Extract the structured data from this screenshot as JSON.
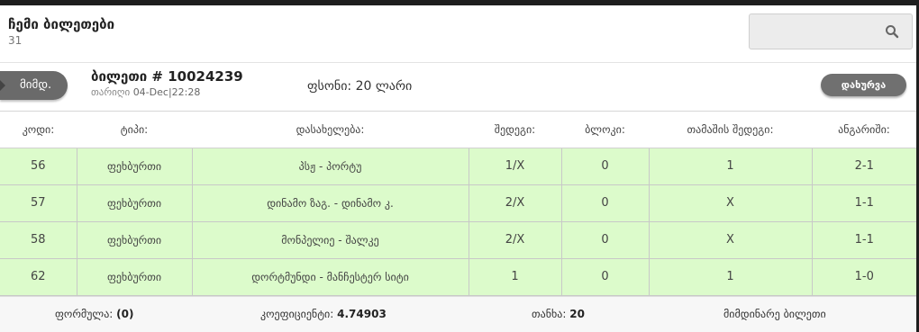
{
  "header": {
    "title": "ჩემი ბილეთები",
    "count": "31"
  },
  "search": {
    "icon": "search-icon"
  },
  "ticket": {
    "status": "მიმდ.",
    "title": "ბილეთი # 10024239",
    "date_label": "თარიღი",
    "date_value": "04-Dec|22:28",
    "price": "ფსონი: 20 ლარი",
    "close_label": "დახურვა"
  },
  "table": {
    "headers": [
      "კოდი:",
      "ტიპი:",
      "დასახელება:",
      "შედეგი:",
      "ბლოკი:",
      "თამაშის შედეგი:",
      "ანგარიში:"
    ],
    "rows": [
      [
        "56",
        "ფეხბურთი",
        "პსჟ - პორტუ",
        "1/X",
        "0",
        "1",
        "2-1"
      ],
      [
        "57",
        "ფეხბურთი",
        "დინამო ზაგ. - დინამო კ.",
        "2/X",
        "0",
        "X",
        "1-1"
      ],
      [
        "58",
        "ფეხბურთი",
        "მონპელიე - შალკე",
        "2/X",
        "0",
        "X",
        "1-1"
      ],
      [
        "62",
        "ფეხბურთი",
        "დორტმუნდი - მანჩესტერ სიტი",
        "1",
        "0",
        "1",
        "1-0"
      ]
    ]
  },
  "footer": {
    "formula_label": "ფორმულა:",
    "formula_value": "(0)",
    "coef_label": "კოეფიციენტი:",
    "coef_value": "4.74903",
    "amount_label": "თანხა:",
    "amount_value": "20",
    "status_text": "მიმდინარე ბილეთი"
  },
  "colors": {
    "row_green": "#dcfbcb",
    "button_gray": "#707070",
    "topbar": "#1e1e1e"
  }
}
